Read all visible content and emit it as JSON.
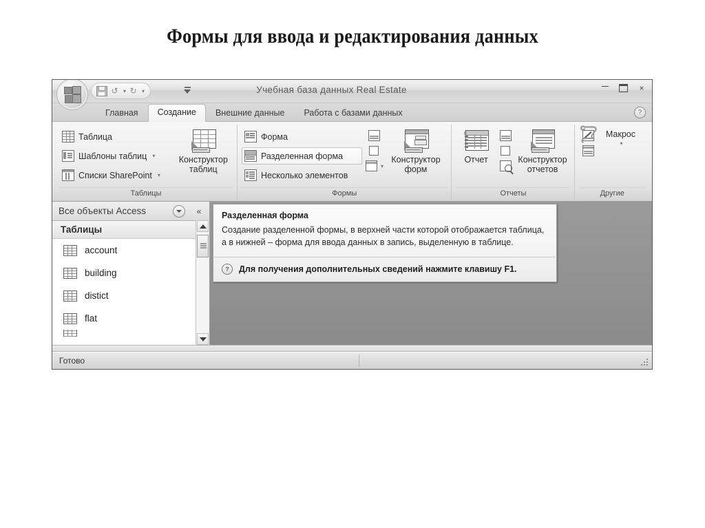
{
  "slide": {
    "title": "Формы для ввода и редактирования данных"
  },
  "window": {
    "title": "Учебная база данных Real Estate",
    "office_button": "office-button",
    "quick_access": {
      "save": "Сохранить",
      "undo": "Отменить",
      "redo": "Вернуть",
      "customize": "Настройка панели быстрого доступа"
    },
    "controls": {
      "minimize": "Свернуть",
      "maximize": "Развернуть",
      "close": "×"
    }
  },
  "ribbon": {
    "help": "?",
    "tabs": [
      {
        "label": "Главная",
        "active": false
      },
      {
        "label": "Создание",
        "active": true
      },
      {
        "label": "Внешние данные",
        "active": false
      },
      {
        "label": "Работа с базами данных",
        "active": false
      }
    ],
    "groups": [
      {
        "label": "Таблицы",
        "items": [
          {
            "label": "Таблица",
            "caret": ""
          },
          {
            "label": "Шаблоны таблиц",
            "caret": "▾"
          },
          {
            "label": "Списки SharePoint",
            "caret": "▾"
          }
        ],
        "big": [
          {
            "line1": "Конструктор",
            "line2": "таблиц"
          }
        ]
      },
      {
        "label": "Формы",
        "items": [
          {
            "label": "Форма",
            "caret": ""
          },
          {
            "label": "Разделенная форма",
            "caret": ""
          },
          {
            "label": "Несколько элементов",
            "caret": ""
          }
        ],
        "big": [
          {
            "line1": "Конструктор",
            "line2": "форм"
          }
        ]
      },
      {
        "label": "Отчеты",
        "items": [],
        "big": [
          {
            "line1": "Отчет",
            "line2": ""
          },
          {
            "line1": "Конструктор",
            "line2": "отчетов"
          }
        ]
      },
      {
        "label": "Другие",
        "items": [],
        "big": [
          {
            "line1": "Макрос",
            "line2": "▾"
          }
        ]
      }
    ]
  },
  "navigation": {
    "header": "Все объекты Access",
    "dropdown": "▾",
    "collapse": "«",
    "group": {
      "label": "Таблицы",
      "chevron": "≪"
    },
    "items": [
      {
        "label": "account"
      },
      {
        "label": "building"
      },
      {
        "label": "distict"
      },
      {
        "label": "flat"
      }
    ]
  },
  "tooltip": {
    "title": "Разделенная форма",
    "body": "Создание разделенной формы, в верхней части которой отображается таблица, а в нижней – форма для ввода данных в запись, выделенную в таблице.",
    "help_icon": "?",
    "footer": "Для получения дополнительных сведений нажмите клавишу F1."
  },
  "status": {
    "text": "Готово"
  },
  "colors": {
    "window_border": "#5d5d5d",
    "ribbon_bg": "#ededed",
    "workspace_bg": "#8e8e8e",
    "active_tab": "#fdfdfd",
    "text": "#2f2f2f"
  }
}
